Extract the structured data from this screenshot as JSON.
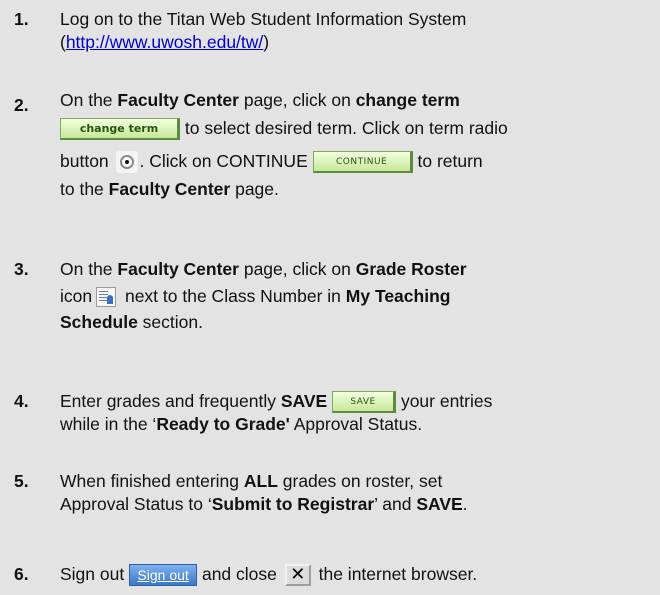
{
  "steps": [
    {
      "number": "1.",
      "line1": "Log on to the Titan Web Student Information System",
      "link_prefix": "(",
      "link": "http://www.uwosh.edu/tw/",
      "link_suffix": ")"
    },
    {
      "number": "2.",
      "t1": "On the ",
      "b1": "Faculty Center",
      "t2": " page, click on ",
      "b2": "change term",
      "button_change_term": "change term",
      "t3": " to select desired term. Click on term radio",
      "t4": "button",
      "t5": ".  Click on CONTINUE",
      "button_continue": "CONTINUE",
      "t6": " to return",
      "t7": "to the ",
      "b3": "Faculty Center",
      "t8": " page."
    },
    {
      "number": "3.",
      "t1": "On the ",
      "b1": "Faculty Center",
      "t2": " page, click on ",
      "b2": "Grade Roster",
      "t3": "icon",
      "t4": " next to the Class Number in ",
      "b3": "My Teaching",
      "b4": "Schedule",
      "t5": " section."
    },
    {
      "number": "4.",
      "t1": "Enter grades and frequently ",
      "b1": "SAVE",
      "button_save": "SAVE",
      "t2": " your entries",
      "t3": "while in the ‘",
      "b2": "Ready to Grade'",
      "t4": " Approval Status."
    },
    {
      "number": "5.",
      "t1": "When finished entering ",
      "b1": "ALL",
      "t2": " grades on roster, set",
      "t3": "Approval Status to ‘",
      "b2": "Submit to Registrar",
      "t4": "’ and ",
      "b3": "SAVE",
      "t5": "."
    },
    {
      "number": "6.",
      "t1": "Sign out",
      "button_signout": "Sign out",
      "t2": " and close",
      "close_glyph": "✕",
      "t3": " the internet browser."
    }
  ]
}
